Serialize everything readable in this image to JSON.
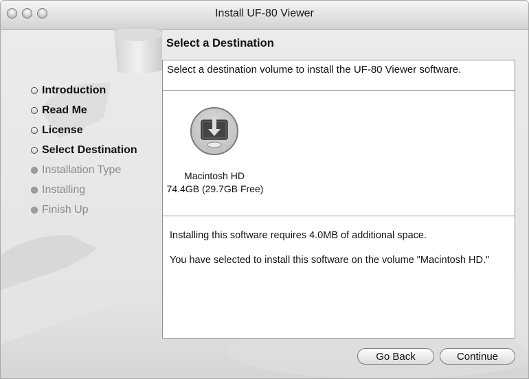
{
  "window": {
    "title": "Install UF-80 Viewer"
  },
  "steps": [
    {
      "label": "Introduction",
      "state": "done"
    },
    {
      "label": "Read Me",
      "state": "done"
    },
    {
      "label": "License",
      "state": "done"
    },
    {
      "label": "Select Destination",
      "state": "current"
    },
    {
      "label": "Installation Type",
      "state": "future"
    },
    {
      "label": "Installing",
      "state": "future"
    },
    {
      "label": "Finish Up",
      "state": "future"
    }
  ],
  "content": {
    "heading": "Select a Destination",
    "description": "Select a destination volume to install the UF-80 Viewer software.",
    "volume": {
      "name": "Macintosh HD",
      "size": "74.4GB (29.7GB Free)"
    },
    "space_required": "Installing this software requires 4.0MB of additional space.",
    "selected_volume_text": "You have selected to install this software on the volume \"Macintosh HD.\""
  },
  "buttons": {
    "go_back": "Go Back",
    "continue": "Continue"
  }
}
